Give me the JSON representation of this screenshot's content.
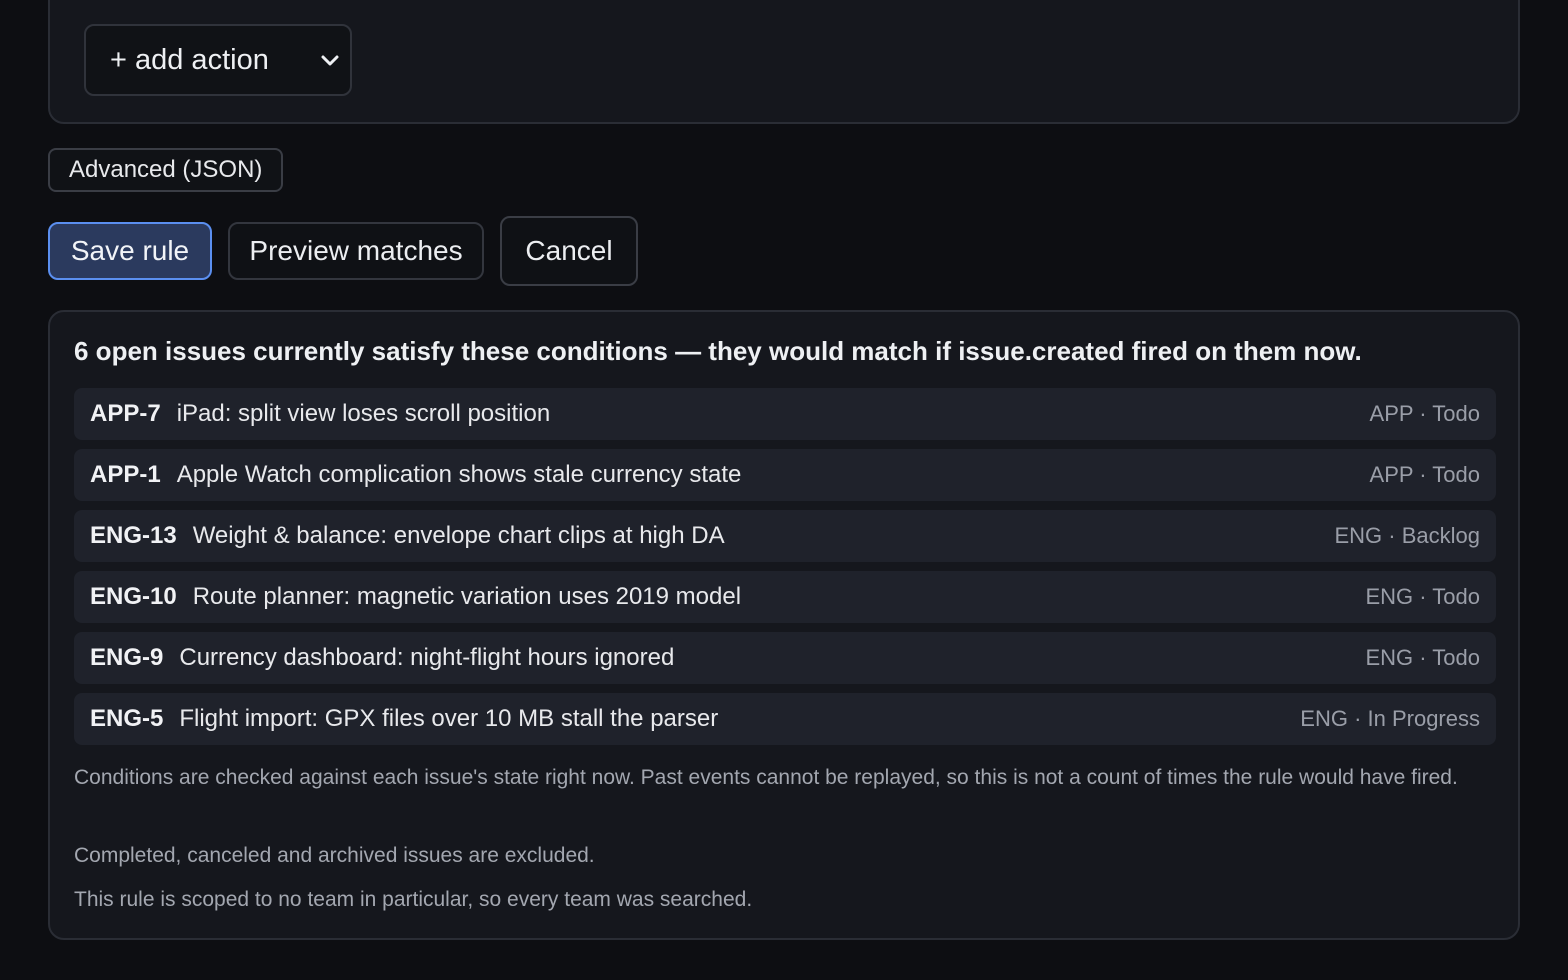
{
  "action_section": {
    "add_action_label": "+ add action"
  },
  "advanced_label": "Advanced (JSON)",
  "buttons": {
    "save": "Save rule",
    "preview": "Preview matches",
    "cancel": "Cancel"
  },
  "preview": {
    "summary": "6 open issues currently satisfy these conditions — they would match if issue.created fired on them now.",
    "issues": [
      {
        "id": "APP-7",
        "title": "iPad: split view loses scroll position",
        "meta": "APP · Todo"
      },
      {
        "id": "APP-1",
        "title": "Apple Watch complication shows stale currency state",
        "meta": "APP · Todo"
      },
      {
        "id": "ENG-13",
        "title": "Weight & balance: envelope chart clips at high DA",
        "meta": "ENG · Backlog"
      },
      {
        "id": "ENG-10",
        "title": "Route planner: magnetic variation uses 2019 model",
        "meta": "ENG · Todo"
      },
      {
        "id": "ENG-9",
        "title": "Currency dashboard: night-flight hours ignored",
        "meta": "ENG · Todo"
      },
      {
        "id": "ENG-5",
        "title": "Flight import: GPX files over 10 MB stall the parser",
        "meta": "ENG · In Progress"
      }
    ],
    "notes": [
      "Conditions are checked against each issue's state right now. Past events cannot be replayed, so this is not a count of times the rule would have fired.",
      "Completed, canceled and archived issues are excluded.",
      "This rule is scoped to no team in particular, so every team was searched."
    ]
  },
  "colors": {
    "background": "#0d0e12",
    "panel": "#15171d",
    "row": "#1f222b",
    "primary_border": "#5b8ff0",
    "primary_fill": "#2b3a5e"
  }
}
